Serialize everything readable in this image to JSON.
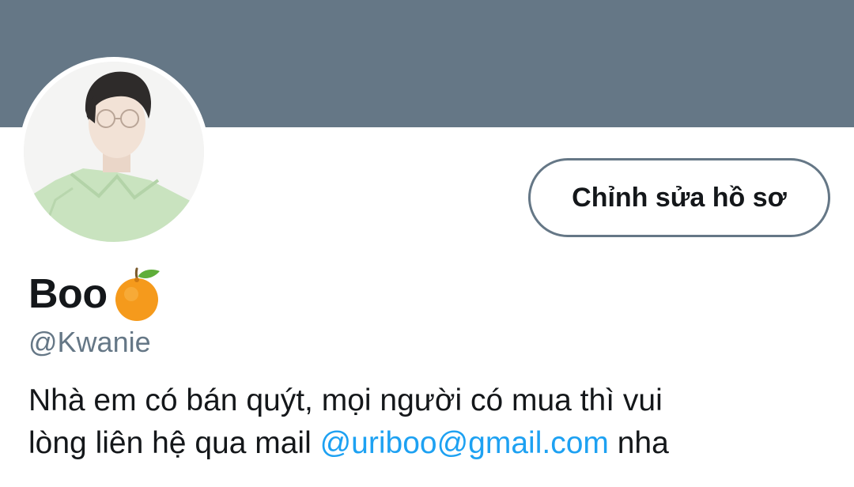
{
  "profile": {
    "banner_color": "#657786",
    "avatar_alt": "profile photo",
    "edit_button_label": "Chỉnh sửa hồ sơ",
    "display_name": "Boo",
    "name_emoji": "tangerine-emoji",
    "handle": "@Kwanie",
    "bio": {
      "line1": "Nhà em có bán quýt, mọi người có mua thì vui",
      "line2_prefix": "lòng liên hệ qua mail ",
      "link_text": "@uriboo@gmail.com",
      "line2_suffix": " nha"
    },
    "link_color": "#1da1f2"
  }
}
